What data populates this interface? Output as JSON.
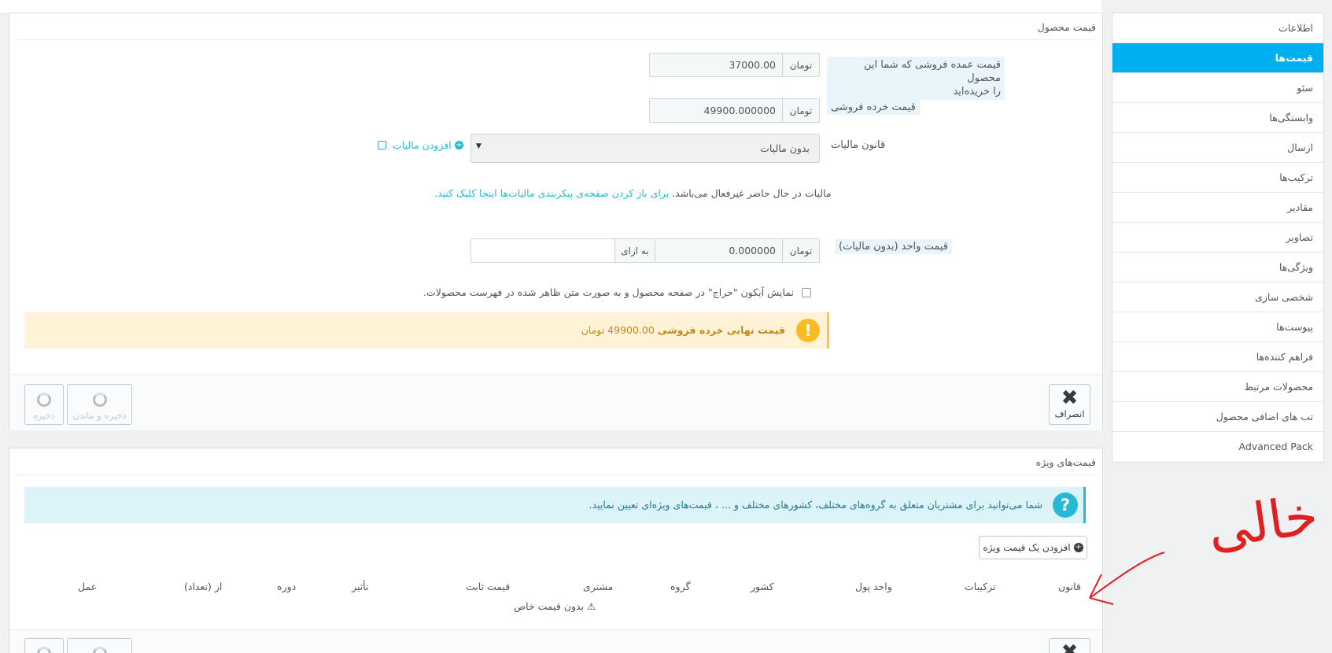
{
  "sidebar": {
    "items": [
      {
        "label": "اطلاعات"
      },
      {
        "label": "قیمت‌ها",
        "active": true
      },
      {
        "label": "سئو"
      },
      {
        "label": "وابستگی‌ها"
      },
      {
        "label": "ارسال"
      },
      {
        "label": "ترکیب‌ها"
      },
      {
        "label": "مقادیر"
      },
      {
        "label": "تصاویر"
      },
      {
        "label": "ویژگی‌ها"
      },
      {
        "label": "شخصی سازی"
      },
      {
        "label": "پیوست‌ها"
      },
      {
        "label": "فراهم کننده‌ها"
      },
      {
        "label": "محصولات مرتبط"
      },
      {
        "label": "تب های اضافی محصول"
      },
      {
        "label": "Advanced Pack"
      }
    ],
    "accent": "#00aff0"
  },
  "price_panel": {
    "title": "قیمت محصول",
    "wholesale": {
      "label_line1": "قیمت عمده فروشی که شما این محصول",
      "label_line2": "را خریده‌اید",
      "currency": "تومان",
      "value": "37000.00"
    },
    "retail": {
      "label": "قیمت خرده فروشی",
      "currency": "تومان",
      "value": "49900.000000"
    },
    "tax": {
      "label": "قانون مالیات",
      "selected": "بدون مالیات",
      "add_link": "افزودن مالیات"
    },
    "tax_notice": {
      "text": "مالیات در حال حاضر غیرفعال می‌باشد.",
      "link": "برای باز کردن صفحه‌ی پیکربندی مالیات‌ها اینجا کلیک کنید."
    },
    "unit_price": {
      "label": "قیمت واحد (بدون مالیات)",
      "currency": "تومان",
      "value": "0.000000",
      "per_label": "به ازای",
      "per_value": ""
    },
    "on_sale": {
      "label": "نمایش آیکون \"حراج\" در صفحه محصول و به صورت متن ظاهر شده در فهرست محصولات."
    },
    "final_price": {
      "label": "قیمت نهایی خرده فروشی",
      "value": "49900.00",
      "currency": "تومان"
    },
    "buttons": {
      "cancel": "انصراف",
      "save_stay": "ذخیره و ماندن",
      "save": "ذخیره"
    }
  },
  "special_panel": {
    "title": "قیمت‌های ویژه",
    "info": "شما می‌توانید برای مشتریان متعلق به گروه‌های مختلف، کشورهای مختلف و ... ، قیمت‌های ویژه‌ای تعیین نمایید.",
    "add_button": "افزودن یک قیمت ویژه",
    "columns": [
      "قانون",
      "ترکیبات",
      "واحد پول",
      "کشور",
      "گروه",
      "مشتری",
      "قیمت ثابت",
      "تأثیر",
      "دوره",
      "از (تعداد)",
      "عمل"
    ],
    "empty": "بدون قیمت خاص"
  },
  "annotation": {
    "text": "خالی",
    "color": "#e02020"
  }
}
